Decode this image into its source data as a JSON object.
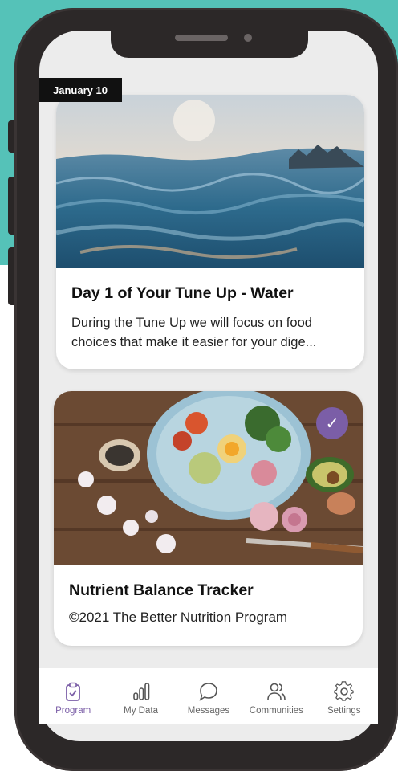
{
  "colors": {
    "teal_background": "#55c2b8",
    "accent_purple": "#7b5ea7",
    "phone_frame": "#2c2828"
  },
  "feed": {
    "date_tag": "January 10",
    "cards": [
      {
        "title": "Day 1 of Your Tune Up - Water",
        "description": "During the Tune Up we will focus on food choices that make it easier for your dige...",
        "image": "ocean-waves-image"
      },
      {
        "title": "Nutrient Balance Tracker",
        "description": "©2021 The Better Nutrition Program",
        "image": "food-bowl-image",
        "completed": true,
        "badge_icon": "checkmark-icon"
      }
    ]
  },
  "tabbar": {
    "tabs": [
      {
        "label": "Program",
        "icon": "clipboard-check-icon",
        "active": true
      },
      {
        "label": "My Data",
        "icon": "bar-chart-icon",
        "active": false
      },
      {
        "label": "Messages",
        "icon": "chat-bubble-icon",
        "active": false
      },
      {
        "label": "Communities",
        "icon": "people-icon",
        "active": false
      },
      {
        "label": "Settings",
        "icon": "gear-icon",
        "active": false
      }
    ]
  }
}
